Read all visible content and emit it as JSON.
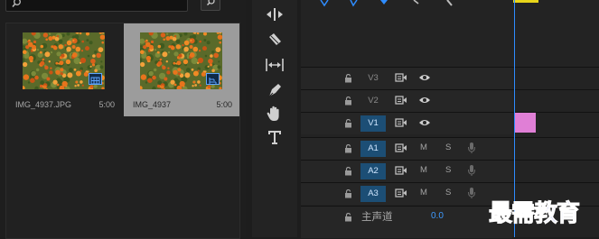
{
  "project": {
    "clips": [
      {
        "name": "IMG_4937.JPG",
        "duration": "5:00",
        "badge": "still-image-icon",
        "selected": false
      },
      {
        "name": "IMG_4937",
        "duration": "5:00",
        "badge": "sequence-icon",
        "selected": true
      }
    ]
  },
  "tools": [
    "ripple-edit-icon",
    "razor-icon",
    "slip-icon",
    "pen-icon",
    "hand-icon",
    "type-icon"
  ],
  "timeline": {
    "video_tracks": [
      {
        "name": "V3",
        "targeted": false
      },
      {
        "name": "V2",
        "targeted": false
      },
      {
        "name": "V1",
        "targeted": true
      }
    ],
    "audio_tracks": [
      {
        "name": "A1",
        "mute": "M",
        "solo": "S"
      },
      {
        "name": "A2",
        "mute": "M",
        "solo": "S"
      },
      {
        "name": "A3",
        "mute": "M",
        "solo": "S"
      }
    ],
    "master": {
      "label": "主声道",
      "value": "0.0"
    },
    "colors": {
      "playhead": "#2e8cff",
      "clip": "#e07fd6",
      "target": "#1c4e75",
      "work_area": "#e8d51a"
    }
  },
  "watermark": "最需教育"
}
